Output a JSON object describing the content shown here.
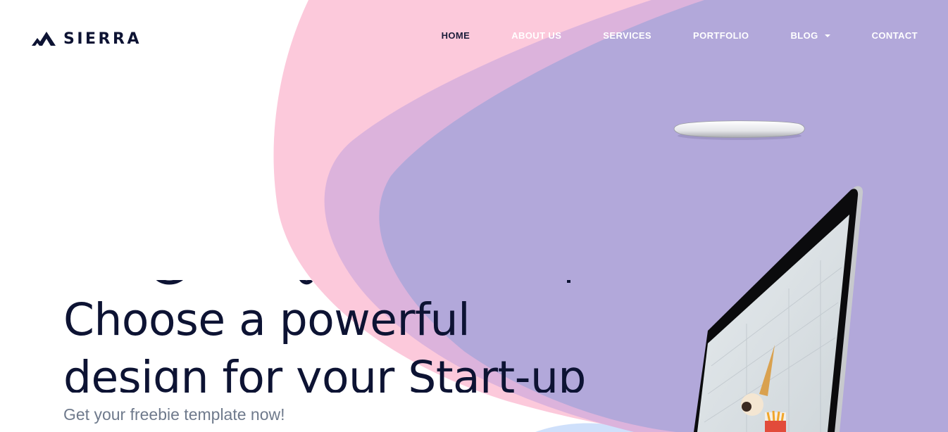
{
  "brand": {
    "name": "SIERRA",
    "logo_icon": "mountain-peaks-icon"
  },
  "nav": {
    "items": [
      {
        "label": "HOME",
        "active": true
      },
      {
        "label": "ABOUT US",
        "active": false
      },
      {
        "label": "SERVICES",
        "active": false
      },
      {
        "label": "PORTFOLIO",
        "active": false
      },
      {
        "label": "BLOG",
        "active": false,
        "dropdown": true
      },
      {
        "label": "CONTACT",
        "active": false
      }
    ]
  },
  "hero": {
    "title_line1": "Choose a powerful",
    "title_line2": "design for your Start-up",
    "subtitle": "Get your freebie template now!"
  },
  "colors": {
    "pink": "#fcc9db",
    "mauve": "#dcb3dc",
    "lavender": "#b2a8da",
    "light_blue": "#cfe0fb",
    "text_dark": "#0d1333",
    "subtitle_gray": "#6f7a8c"
  }
}
